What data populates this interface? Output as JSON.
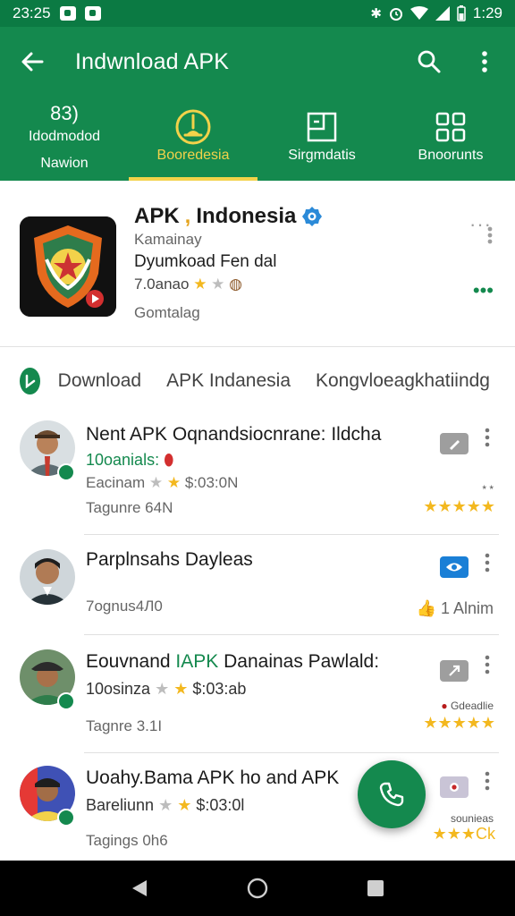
{
  "status_bar": {
    "time_left": "23:25",
    "time_right": "1:29"
  },
  "app_bar": {
    "title": "Indwnload APK"
  },
  "tabs": [
    {
      "line1": "83)",
      "line2": "Idodmodod",
      "line3": "Nawion"
    },
    {
      "label": "Booredesia"
    },
    {
      "label": "Sirgmdatis"
    },
    {
      "label": "Bnoorunts"
    }
  ],
  "app": {
    "name": "APK",
    "name_dot": ",",
    "name_rest": "Indonesia",
    "developer": "Kamainay",
    "description": "Dyumkoad Fen dal",
    "rating_text": "7.0anao",
    "category": "Gomtalag"
  },
  "chips": {
    "first": "Download",
    "second": "APK Indanesia",
    "third": "Kongvloeagkhatiindg"
  },
  "list": [
    {
      "title": "Nent APK Oqnandsiocnrane: Ildcha",
      "line2_green": "10oanials:",
      "line3": "Eacinam",
      "line3_price": "$:03:0N",
      "line4": "Tagunre 64N",
      "small": "* *",
      "rating_stars": "★★★★★"
    },
    {
      "title": "Parplnsahs Dayleas",
      "line3": "7ognus4Л0",
      "likes": "1 Alnim"
    },
    {
      "title_a": "Eouvnand ",
      "title_hl": "IAPK",
      "title_b": " Danainas Pawlald:",
      "line2": "10osinza",
      "line2_price": "$:03:ab",
      "line4": "Tagnre 3.1I",
      "small": "Gdeadlie",
      "rating_stars": "★★★★★"
    },
    {
      "title": "Uoahy.Bama APK ho and APK",
      "line2": "Bareliunn",
      "line2_price": "$:03:0l",
      "line4": "Tagings 0h6",
      "small": "sounieas",
      "rating_stars": "★★★Ck"
    }
  ],
  "colors": {
    "primary": "#14894e",
    "status": "#0b7a43",
    "accent": "#f2d24a",
    "star": "#f3b81f"
  }
}
